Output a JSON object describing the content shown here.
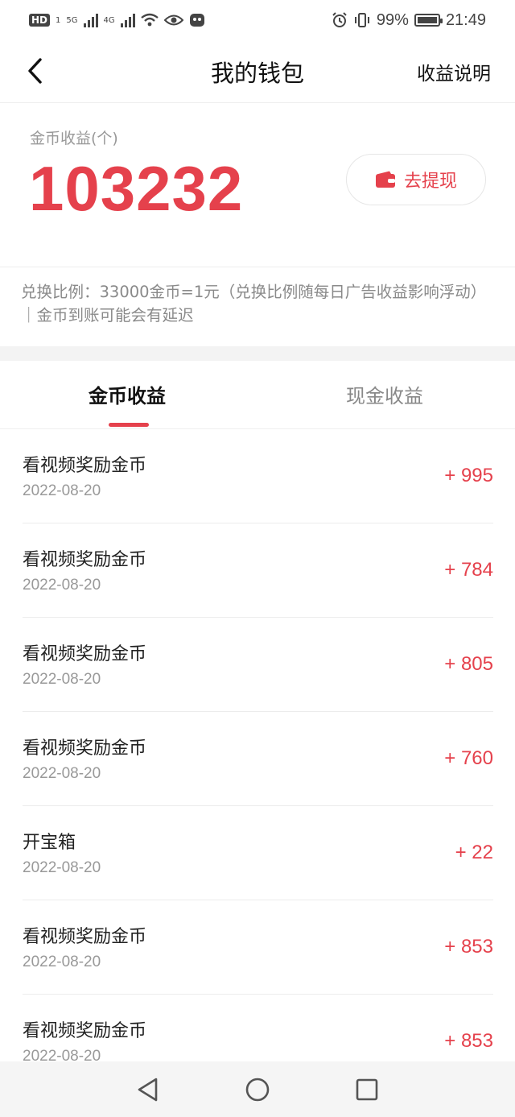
{
  "status_bar": {
    "hd": "HD",
    "sim": "1",
    "net1": "5G",
    "net2": "4G",
    "battery": "99%",
    "time": "21:49"
  },
  "header": {
    "title": "我的钱包",
    "right_link": "收益说明"
  },
  "balance": {
    "label": "金币收益(个)",
    "value": "103232",
    "withdraw_label": "去提现"
  },
  "notice": "兑换比例：33000金币=1元（兑换比例随每日广告收益影响浮动）｜金币到账可能会有延迟",
  "tabs": [
    {
      "label": "金币收益",
      "active": true
    },
    {
      "label": "现金收益",
      "active": false
    }
  ],
  "records": [
    {
      "title": "看视频奖励金币",
      "date": "2022-08-20",
      "amount": "+ 995"
    },
    {
      "title": "看视频奖励金币",
      "date": "2022-08-20",
      "amount": "+ 784"
    },
    {
      "title": "看视频奖励金币",
      "date": "2022-08-20",
      "amount": "+ 805"
    },
    {
      "title": "看视频奖励金币",
      "date": "2022-08-20",
      "amount": "+ 760"
    },
    {
      "title": "开宝箱",
      "date": "2022-08-20",
      "amount": "+ 22"
    },
    {
      "title": "看视频奖励金币",
      "date": "2022-08-20",
      "amount": "+ 853"
    },
    {
      "title": "看视频奖励金币",
      "date": "2022-08-20",
      "amount": "+ 853"
    }
  ],
  "colors": {
    "accent": "#e5414c",
    "muted": "#999999"
  },
  "icons": [
    "back-arrow-icon",
    "wallet-icon",
    "nav-back-icon",
    "nav-home-icon",
    "nav-recents-icon"
  ]
}
